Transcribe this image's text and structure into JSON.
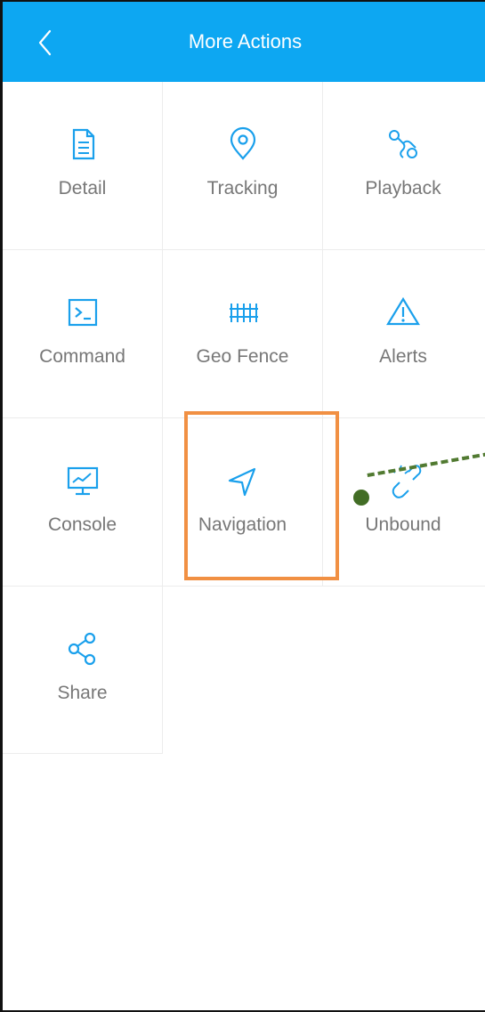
{
  "header": {
    "title": "More Actions"
  },
  "actions": [
    {
      "label": "Detail",
      "icon": "document-icon"
    },
    {
      "label": "Tracking",
      "icon": "location-pin-icon"
    },
    {
      "label": "Playback",
      "icon": "route-icon"
    },
    {
      "label": "Command",
      "icon": "terminal-icon"
    },
    {
      "label": "Geo Fence",
      "icon": "fence-icon"
    },
    {
      "label": "Alerts",
      "icon": "warning-icon"
    },
    {
      "label": "Console",
      "icon": "monitor-icon"
    },
    {
      "label": "Navigation",
      "icon": "navigation-arrow-icon"
    },
    {
      "label": "Unbound",
      "icon": "broken-link-icon"
    },
    {
      "label": "Share",
      "icon": "share-icon"
    }
  ],
  "colors": {
    "header": "#0da7f2",
    "icon": "#1aa0ec",
    "label": "#777777",
    "highlight": "#f19043",
    "pointer": "#517a31"
  }
}
